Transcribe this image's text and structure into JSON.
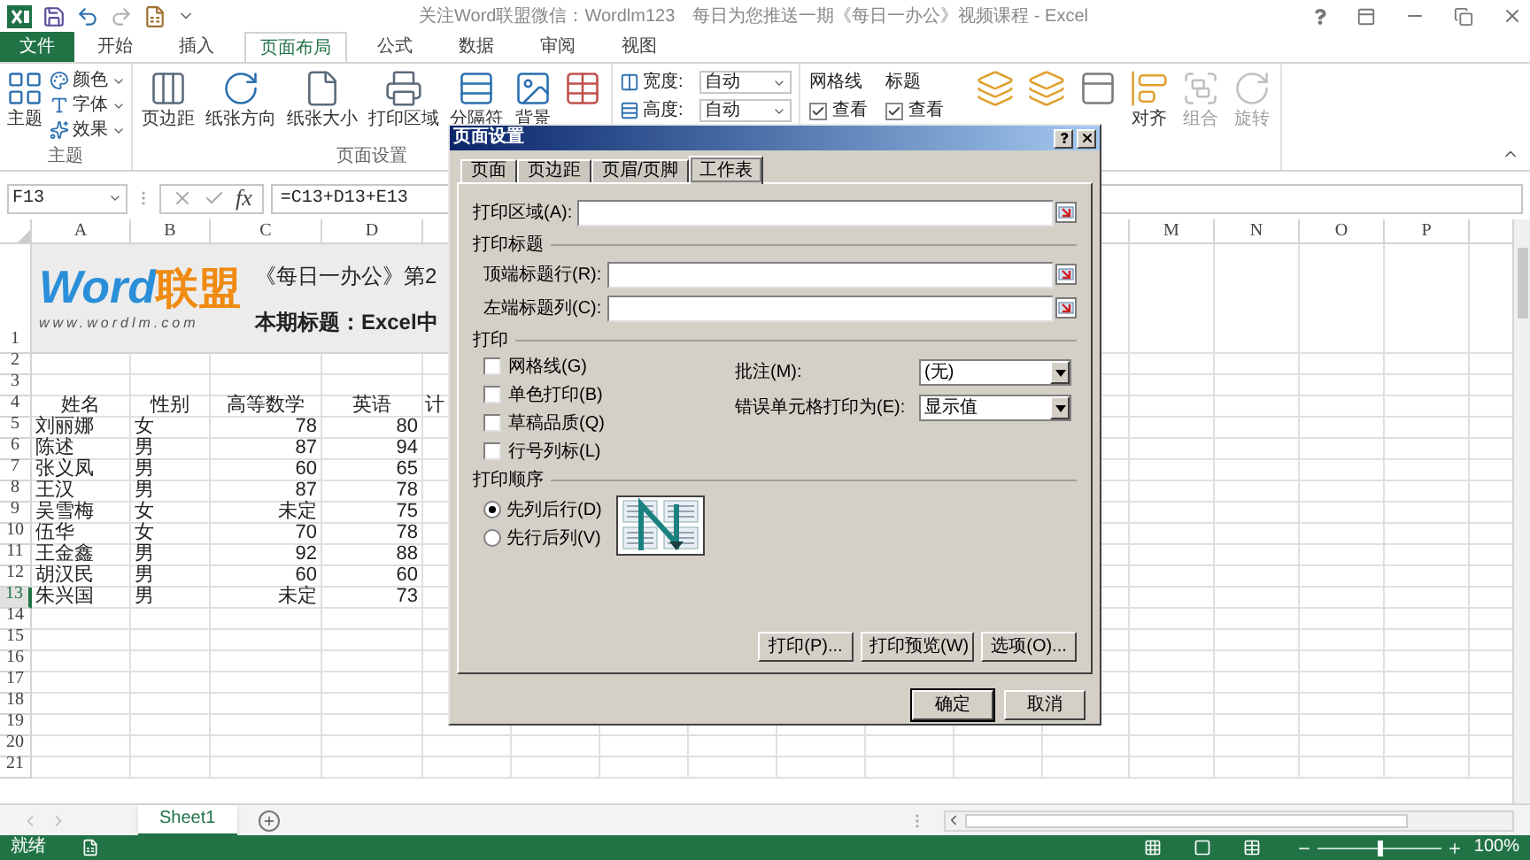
{
  "window": {
    "title": "关注Word联盟微信：Wordlm123　每日为您推送一期《每日一办公》视频课程 - Excel"
  },
  "ribbon": {
    "tabs": [
      {
        "label": "文件",
        "selected": false,
        "kind": "file"
      },
      {
        "label": "开始",
        "selected": false,
        "kind": "tab"
      },
      {
        "label": "插入",
        "selected": false,
        "kind": "tab"
      },
      {
        "label": "页面布局",
        "selected": true,
        "kind": "tab"
      },
      {
        "label": "公式",
        "selected": false,
        "kind": "tab"
      },
      {
        "label": "数据",
        "selected": false,
        "kind": "tab"
      },
      {
        "label": "审阅",
        "selected": false,
        "kind": "tab"
      },
      {
        "label": "视图",
        "selected": false,
        "kind": "tab"
      }
    ],
    "theme_group": {
      "label": "主题",
      "button": "主题",
      "items": [
        "颜色",
        "字体",
        "效果"
      ]
    },
    "page_setup_group": {
      "label": "页面设置",
      "buttons": [
        {
          "label": "页边距",
          "kind": "margins"
        },
        {
          "label": "纸张方向",
          "kind": "orientation"
        },
        {
          "label": "纸张大小",
          "kind": "size"
        },
        {
          "label": "打印区域",
          "kind": "print-area"
        },
        {
          "label": "分隔符",
          "kind": "breaks"
        },
        {
          "label": "背景",
          "kind": "background"
        },
        {
          "kind": "print-titles"
        }
      ]
    },
    "scale_group": {
      "fields": [
        {
          "label": "宽度:",
          "value": "自动"
        },
        {
          "label": "高度:",
          "value": "自动"
        }
      ]
    },
    "sheet_options": [
      {
        "heading": "网格线",
        "label": "查看",
        "checked": true
      },
      {
        "heading": "标题",
        "label": "查看",
        "checked": true
      }
    ],
    "arrange_group": {
      "buttons": [
        {
          "kind": "bring-forward",
          "disabled": false
        },
        {
          "kind": "send-backward",
          "disabled": false
        },
        {
          "kind": "selection-pane",
          "disabled": false
        },
        {
          "label": "对齐",
          "kind": "align",
          "disabled": false
        },
        {
          "label": "组合",
          "kind": "group",
          "disabled": true
        },
        {
          "label": "旋转",
          "kind": "rotate",
          "disabled": true
        }
      ]
    }
  },
  "formula_bar": {
    "name_box": "F13",
    "function_symbol": "fx",
    "formula": "=C13+D13+E13"
  },
  "sheet": {
    "columns_left": [
      "A",
      "B",
      "C",
      "D"
    ],
    "columns_right": [
      "M",
      "N",
      "O",
      "P"
    ],
    "row_headers": [
      {
        "label": "1",
        "selected": false
      },
      {
        "label": "2",
        "selected": false
      },
      {
        "label": "3",
        "selected": false
      },
      {
        "label": "4",
        "selected": false
      },
      {
        "label": "5",
        "selected": false
      },
      {
        "label": "6",
        "selected": false
      },
      {
        "label": "7",
        "selected": false
      },
      {
        "label": "8",
        "selected": false
      },
      {
        "label": "9",
        "selected": false
      },
      {
        "label": "10",
        "selected": false
      },
      {
        "label": "11",
        "selected": false
      },
      {
        "label": "12",
        "selected": false
      },
      {
        "label": "13",
        "selected": true
      },
      {
        "label": "14",
        "selected": false
      },
      {
        "label": "15",
        "selected": false
      },
      {
        "label": "16",
        "selected": false
      },
      {
        "label": "17",
        "selected": false
      },
      {
        "label": "18",
        "selected": false
      },
      {
        "label": "19",
        "selected": false
      },
      {
        "label": "20",
        "selected": false
      },
      {
        "label": "21",
        "selected": false
      }
    ],
    "banner": {
      "logo_word": "Word",
      "logo_cn": "联盟",
      "logo_url": "www.wordlm.com",
      "title": "《每日一办公》第2",
      "subtitle": "本期标题：Excel中"
    },
    "header_row": [
      "姓名",
      "性别",
      "高等数学",
      "英语",
      "计"
    ],
    "data_rows": [
      [
        "刘丽娜",
        "女",
        "78",
        "80"
      ],
      [
        "陈述",
        "男",
        "87",
        "94"
      ],
      [
        "张义凤",
        "男",
        "60",
        "65"
      ],
      [
        "王汉",
        "男",
        "87",
        "78"
      ],
      [
        "吴雪梅",
        "女",
        "未定",
        "75"
      ],
      [
        "伍华",
        "女",
        "70",
        "78"
      ],
      [
        "王金鑫",
        "男",
        "92",
        "88"
      ],
      [
        "胡汉民",
        "男",
        "60",
        "60"
      ],
      [
        "朱兴国",
        "男",
        "未定",
        "73"
      ]
    ]
  },
  "sheet_tabs": [
    {
      "label": "Sheet1",
      "selected": true
    }
  ],
  "status_bar": {
    "status": "就绪",
    "zoom": "100%",
    "zoom_slider": {
      "level": 0.5
    }
  },
  "dialog": {
    "title": "页面设置",
    "tabs": [
      {
        "label": "页面",
        "selected": false
      },
      {
        "label": "页边距",
        "selected": false
      },
      {
        "label": "页眉/页脚",
        "selected": false
      },
      {
        "label": "工作表",
        "selected": true
      }
    ],
    "print_area": {
      "label": "打印区域(A):"
    },
    "print_titles": {
      "heading": "打印标题",
      "fields": [
        {
          "label": "顶端标题行(R):"
        },
        {
          "label": "左端标题列(C):"
        }
      ]
    },
    "print": {
      "heading": "打印",
      "checkboxes": [
        {
          "label": "网格线(G)",
          "checked": false
        },
        {
          "label": "单色打印(B)",
          "checked": false
        },
        {
          "label": "草稿品质(Q)",
          "checked": false
        },
        {
          "label": "行号列标(L)",
          "checked": false
        }
      ],
      "dropdowns": [
        {
          "label": "批注(M):",
          "value": "(无)"
        },
        {
          "label": "错误单元格打印为(E):",
          "value": "显示值"
        }
      ]
    },
    "order": {
      "heading": "打印顺序",
      "options": [
        {
          "label": "先列后行(D)",
          "selected": true
        },
        {
          "label": "先行后列(V)",
          "selected": false
        }
      ]
    },
    "buttons": [
      "打印(P)...",
      "打印预览(W)",
      "选项(O)..."
    ],
    "footer_buttons": [
      {
        "label": "确定",
        "default": true
      },
      {
        "label": "取消",
        "default": false
      }
    ]
  }
}
